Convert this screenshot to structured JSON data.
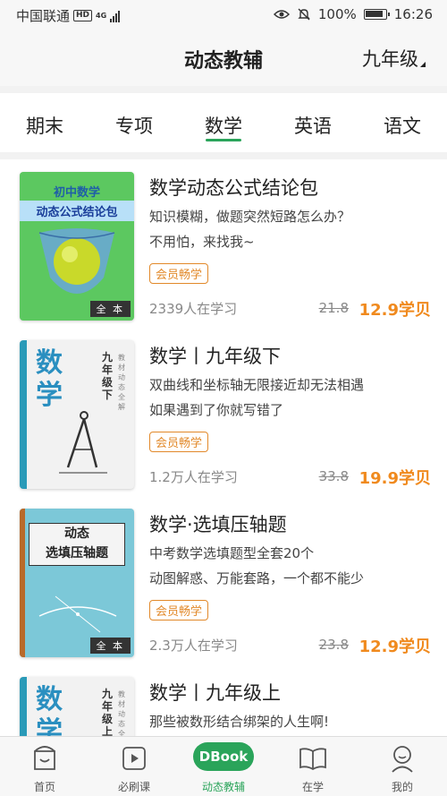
{
  "status_bar": {
    "carrier": "中国联通",
    "hd": "HD",
    "network": "4G",
    "battery": "100%",
    "time": "16:26"
  },
  "header": {
    "title": "动态教辅",
    "grade": "九年级"
  },
  "tabs": [
    {
      "label": "期末",
      "active": false
    },
    {
      "label": "专项",
      "active": false
    },
    {
      "label": "数学",
      "active": true
    },
    {
      "label": "英语",
      "active": false
    },
    {
      "label": "语文",
      "active": false
    }
  ],
  "cards": [
    {
      "cover": {
        "line1": "初中数学",
        "line2": "动态公式结论包",
        "badge": "全 本"
      },
      "title": "数学动态公式结论包",
      "desc1": "知识模糊，做题突然短路怎么办？",
      "desc2": "不用怕，来找我~",
      "tag": "会员畅学",
      "learners": "2339人在学习",
      "old_price": "21.8",
      "price": "12.9学贝"
    },
    {
      "cover": {
        "big": "数学",
        "vertical1": "九年级下",
        "vertical2": "教材动态全解"
      },
      "title": "数学丨九年级下",
      "desc1": "双曲线和坐标轴无限接近却无法相遇",
      "desc2": "如果遇到了你就写错了",
      "tag": "会员畅学",
      "learners": "1.2万人在学习",
      "old_price": "33.8",
      "price": "19.9学贝"
    },
    {
      "cover": {
        "line1": "动态",
        "line2": "选填压轴题",
        "badge": "全 本"
      },
      "title": "数学·选填压轴题",
      "desc1": "中考数学选填题型全套20个",
      "desc2": "动图解惑、万能套路，一个都不能少",
      "tag": "会员畅学",
      "learners": "2.3万人在学习",
      "old_price": "23.8",
      "price": "12.9学贝"
    },
    {
      "cover": {
        "big": "数学",
        "vertical1": "九年级上",
        "vertical2": "教材动态全"
      },
      "title": "数学丨九年级上",
      "desc1": "那些被数形结合绑架的人生啊!"
    }
  ],
  "bottom_nav": [
    {
      "label": "首页",
      "icon": "home-icon"
    },
    {
      "label": "必刷课",
      "icon": "play-icon"
    },
    {
      "label": "动态教辅",
      "icon": "dbook-icon",
      "badge": "DBook",
      "active": true
    },
    {
      "label": "在学",
      "icon": "book-icon"
    },
    {
      "label": "我的",
      "icon": "profile-icon"
    }
  ],
  "colors": {
    "accent": "#2aa45a",
    "price": "#f08a1e",
    "tag": "#e2892a"
  }
}
